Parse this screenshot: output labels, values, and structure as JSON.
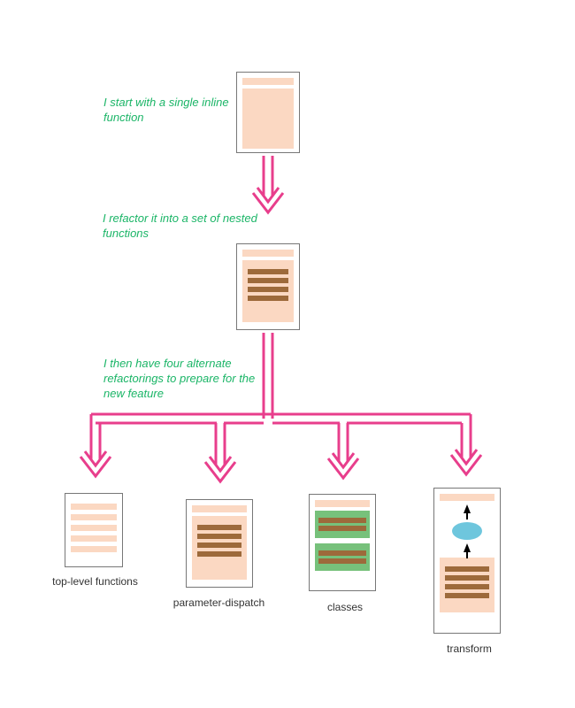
{
  "annotations": {
    "step1": "I start with a single inline function",
    "step2": "I refactor it into a set of nested functions",
    "step3": "I then have four alternate refactorings to prepare for the new feature"
  },
  "leaves": {
    "topLevel": "top-level functions",
    "paramDispatch": "parameter-dispatch",
    "classes": "classes",
    "transform": "transform"
  },
  "colors": {
    "arrow": "#e83e8c",
    "annotation": "#1bb567",
    "peach": "#fbd8c2",
    "brown": "#9d6a3b",
    "green": "#77c17b",
    "cyan": "#6ec6dd"
  }
}
